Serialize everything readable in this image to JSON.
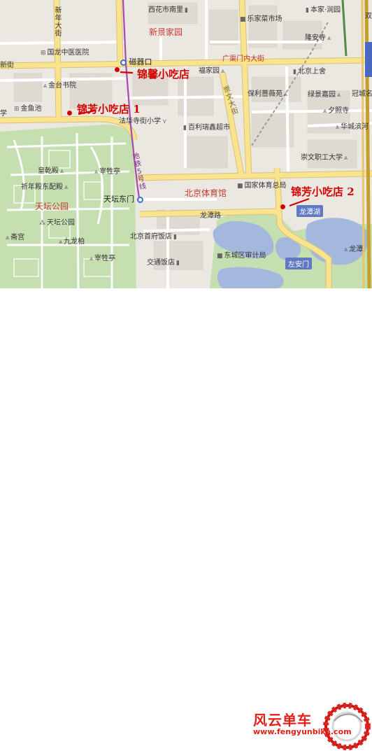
{
  "map": {
    "roads": {
      "main_road": "广渠门内大街",
      "side_road": "新街",
      "east_road": "崇文大街",
      "metro_line": "地铁5号线",
      "lake_road": "龙潭路",
      "north_avenue": "新年大街"
    },
    "places": {
      "park": "天坛公园",
      "stadium": "北京体育馆",
      "jingyuan": "新景家园"
    },
    "pois": {
      "xihuashi": "西花市南里",
      "lejia": "乐家菜市场",
      "benjia": "本家·润园",
      "longan": "隆安寺",
      "hospital": "国龙中医医院",
      "citang": "磁器口",
      "jintai": "金台书院",
      "fuyuan": "福家园",
      "bjshangshe": "北京上舍",
      "jinyu": "金鱼池",
      "baoli": "保利蔷薇苑",
      "lvmeng": "绿景嘉园",
      "guanyu": "冠城名",
      "xizhao": "夕照寺",
      "huacheng": "华城滨河",
      "fahua": "法华寺街小学",
      "baili": "百利瑞鑫超市",
      "chongwen_univ": "崇文职工大学",
      "huanggan": "皇乾殿",
      "zaisheng_ting": "宰牲亭",
      "qinian": "祈年殿东配殿",
      "tiantan_poi": "天坛公园",
      "guojia": "国家体育总局",
      "zhaigong": "斋宫",
      "jiulongbai": "九龙柏",
      "bj_shoufu": "北京首府饭店",
      "zaisheng_ting2": "宰牲亭",
      "dongcheng": "东城区审计局",
      "jiaotong": "交通饭店",
      "zuoanmen": "左安门",
      "longtanhu": "龙潭湖",
      "longtan_east": "龙潭",
      "shuangguan": "双",
      "cut_hospital": "学",
      "west_street": "街"
    },
    "stations": {
      "ciqikou": "磁器口",
      "tiantan_dongmen": "天坛东门"
    }
  },
  "annotations": {
    "jinxin": "锦馨小吃店",
    "jinfang1": "锦芳小吃店 1",
    "jinfang2": "锦芳小吃店 2"
  },
  "logo": {
    "brand": "风云单车",
    "url": "www.fengyunbike.com"
  },
  "colors": {
    "annotation_red": "#d40000",
    "park_green": "#c5dfb1",
    "water_blue": "#a3b8dc",
    "major_road": "#f9e38f",
    "metro_line": "#a64ab0",
    "logo_red": "#e0201a"
  }
}
